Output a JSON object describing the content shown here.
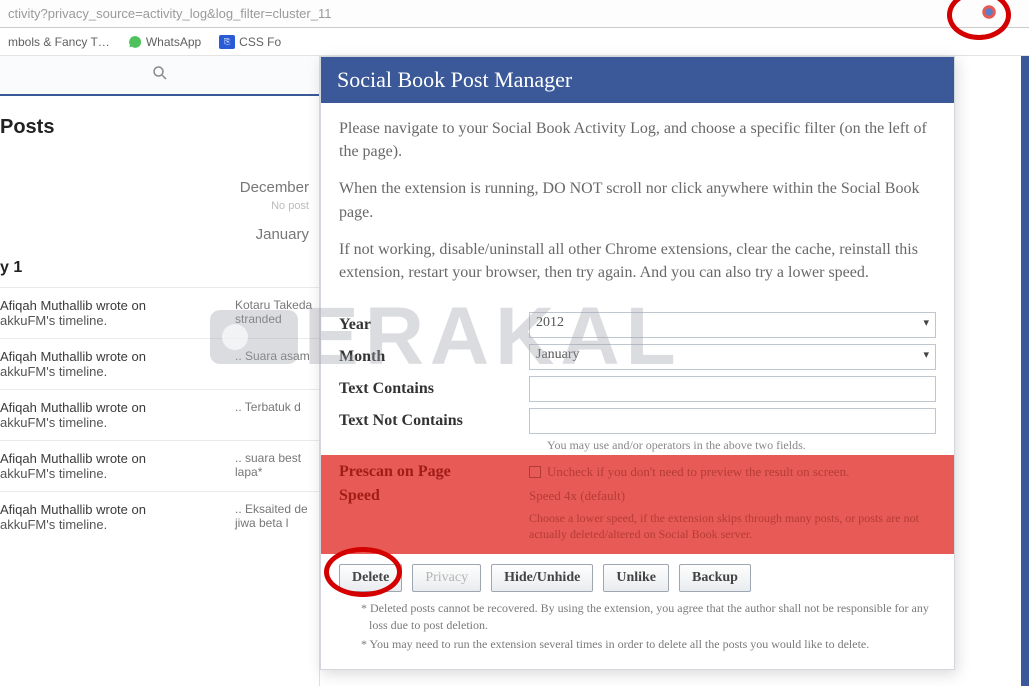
{
  "urlbar": {
    "url": "ctivity?privacy_source=activity_log&log_filter=cluster_11"
  },
  "bookmarks": [
    {
      "label": "mbols & Fancy T…"
    },
    {
      "label": "WhatsApp"
    },
    {
      "label": "CSS Fo"
    }
  ],
  "left": {
    "posts_heading": "Posts",
    "dec": "December",
    "dec_sub": "No post",
    "jan": "January",
    "year_row": "y 1",
    "items": [
      {
        "meta_top": "Afiqah Muthallib wrote on",
        "meta_sub": "akkuFM's timeline.",
        "preview_top": "Kotaru Takeda",
        "preview_sub": "stranded"
      },
      {
        "meta_top": "Afiqah Muthallib wrote on",
        "meta_sub": "akkuFM's timeline.",
        "preview_top": ".. Suara asam"
      },
      {
        "meta_top": "Afiqah Muthallib wrote on",
        "meta_sub": "akkuFM's timeline.",
        "preview_top": ".. Terbatuk d"
      },
      {
        "meta_top": "Afiqah Muthallib wrote on",
        "meta_sub": "akkuFM's timeline.",
        "preview_top": ".. suara best",
        "preview_sub": "lapa*"
      },
      {
        "meta_top": "Afiqah Muthallib wrote on",
        "meta_sub": "akkuFM's timeline.",
        "preview_top": ".. Eksaited de",
        "preview_sub": "jiwa beta l"
      }
    ]
  },
  "popup": {
    "title": "Social Book Post Manager",
    "p1": "Please navigate to your Social Book Activity Log, and choose a specific filter (on the left of the page).",
    "p2": "When the extension is running, DO NOT scroll nor click anywhere within the Social Book page.",
    "p3": "If not working, disable/uninstall all other Chrome extensions, clear the cache, reinstall this extension, restart your browser, then try again. And you can also try a lower speed.",
    "labels": {
      "year": "Year",
      "month": "Month",
      "text_contains": "Text Contains",
      "text_not_contains": "Text Not Contains",
      "prescan": "Prescan on Page",
      "speed": "Speed"
    },
    "values": {
      "year": "2012",
      "month": "January",
      "text_contains": "",
      "text_not_contains": "",
      "speed": "Speed 4x (default)"
    },
    "helpers": {
      "andor": "You may use and/or operators in the above two fields.",
      "prescan": "Uncheck if you don't need to preview the result on screen.",
      "speed": "Choose a lower speed, if the extension skips through many posts, or posts are not actually deleted/altered on Social Book server."
    },
    "buttons": {
      "delete": "Delete",
      "privacy": "Privacy",
      "hide": "Hide/Unhide",
      "unlike": "Unlike",
      "backup": "Backup"
    },
    "footnotes": {
      "f1": "* Deleted posts cannot be recovered. By using the extension, you agree that the author shall not be responsible for any loss due to post deletion.",
      "f2": "* You may need to run the extension several times in order to delete all the posts you would like to delete."
    }
  },
  "watermark": "ERAKAL"
}
